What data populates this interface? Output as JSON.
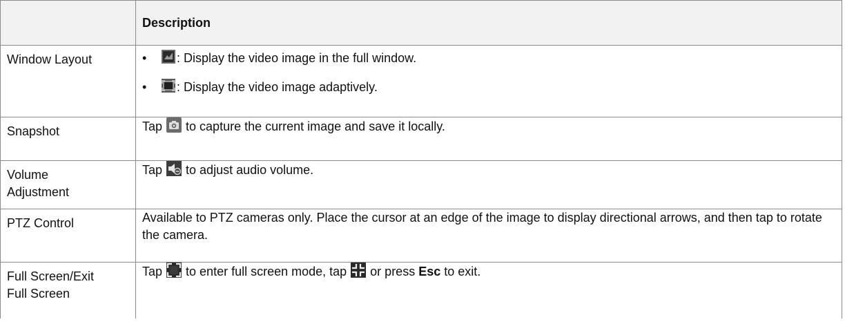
{
  "table": {
    "header": {
      "col1": "",
      "col2": "Description"
    },
    "rows": [
      {
        "label": "Window Layout",
        "bullets": [
          {
            "icon": "full-window-icon",
            "text": ": Display the video image in the full window."
          },
          {
            "icon": "adaptive-window-icon",
            "text": ": Display the video image adaptively."
          }
        ]
      },
      {
        "label": "Snapshot",
        "before": "Tap ",
        "icon": "camera-icon",
        "after": " to capture the current image and save it locally."
      },
      {
        "label_line1": "Volume",
        "label_line2": "Adjustment",
        "before": "Tap ",
        "icon": "speaker-icon",
        "after": " to adjust audio volume."
      },
      {
        "label": "PTZ Control",
        "text": "Available to PTZ cameras only. Place the cursor at an edge of the image to display directional arrows, and then tap to rotate the camera."
      },
      {
        "label_line1": "Full Screen/Exit",
        "label_line2": "Full Screen",
        "before": "Tap ",
        "icon1": "enter-fullscreen-icon",
        "middle": " to enter full screen mode, tap ",
        "icon2": "exit-fullscreen-icon",
        "middle2": " or press ",
        "key": "Esc",
        "after": " to exit."
      }
    ]
  },
  "colors": {
    "border": "#8a8a8a",
    "header_bg": "#f2f2f2",
    "icon_dark": "#2b2b2b",
    "icon_light": "#6a6a6a"
  }
}
